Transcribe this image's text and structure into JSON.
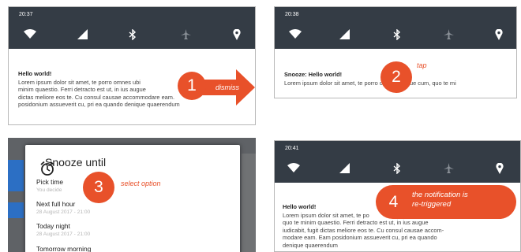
{
  "colors": {
    "accent": "#e8512a",
    "statusbar": "#343c45"
  },
  "panels": [
    {
      "time": "20:37",
      "icons": [
        "wifi-icon",
        "signal-icon",
        "bluetooth-icon",
        "airplane-mode-icon",
        "location-icon"
      ],
      "notification": {
        "title": "Hello world!",
        "lines": [
          "Lorem ipsum dolor sit amet, te porro omnes ubi",
          "minim quaestio. Ferri detracto est ut, in ius augue",
          "dictas meliore eos te. Cu consul causae accommodare eam.",
          "posidonium assueverit cu, pri ea quando denique quaerendum"
        ]
      },
      "step": "1",
      "hint": "dismiss"
    },
    {
      "time": "20:38",
      "icons": [
        "wifi-icon",
        "signal-icon",
        "bluetooth-icon",
        "airplane-mode-icon",
        "location-icon"
      ],
      "notification": {
        "title": "Snooze: Hello world!",
        "lines": [
          "Lorem ipsum dolor sit amet, te porro omnes ubique cum, quo te mi"
        ]
      },
      "step": "2",
      "hint": "tap"
    },
    {
      "dialog_title": "Snooze until",
      "options": [
        {
          "label": "Pick time",
          "sub": "You decide"
        },
        {
          "label": "Next full hour",
          "sub": "28 August 2017 - 21:00"
        },
        {
          "label": "Today night",
          "sub": "28 August 2017 - 21:00"
        },
        {
          "label": "Tomorrow morning",
          "sub": ""
        }
      ],
      "step": "3",
      "hint": "select option"
    },
    {
      "time": "20:41",
      "icons": [
        "wifi-icon",
        "signal-icon",
        "bluetooth-icon",
        "airplane-mode-icon",
        "location-icon"
      ],
      "notification": {
        "title": "Hello world!",
        "lines": [
          "Lorem ipsum dolor sit amet, te po",
          "quo te minim quaestio. Ferri detracto est ut, in ius augue",
          "iudicabit, fugit dictas meliore eos te. Cu consul causae accom-",
          "modare eam. Eam posidonium assueverit cu, pri ea quando",
          "denique quaerendum"
        ]
      },
      "step": "4",
      "hint_lines": [
        "the notification is",
        "re-triggered"
      ]
    }
  ]
}
